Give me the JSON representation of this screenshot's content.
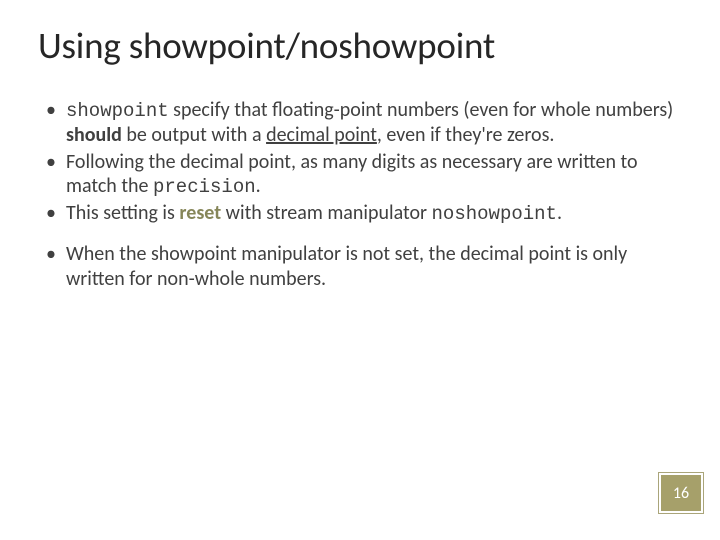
{
  "title": "Using showpoint/noshowpoint",
  "bullets": {
    "b1": {
      "code1": "showpoint",
      "t1": " specify that floating-point numbers (even for whole numbers) ",
      "bold1": "should",
      "t2": " be output with a ",
      "u1": "decimal point",
      "t3": ", even if they're zeros."
    },
    "b2": {
      "t1": "Following the decimal point, as many digits as necessary are written to match the ",
      "code1": "precision",
      "t2": "."
    },
    "b3": {
      "t1": "This setting is ",
      "green1": "reset",
      "t2": " with stream manipulator ",
      "code1": "noshowpoint",
      "t3": "."
    },
    "b4": {
      "t1": "When the showpoint  manipulator is not set, the decimal point is only written for non-whole numbers."
    }
  },
  "page_number": "16"
}
